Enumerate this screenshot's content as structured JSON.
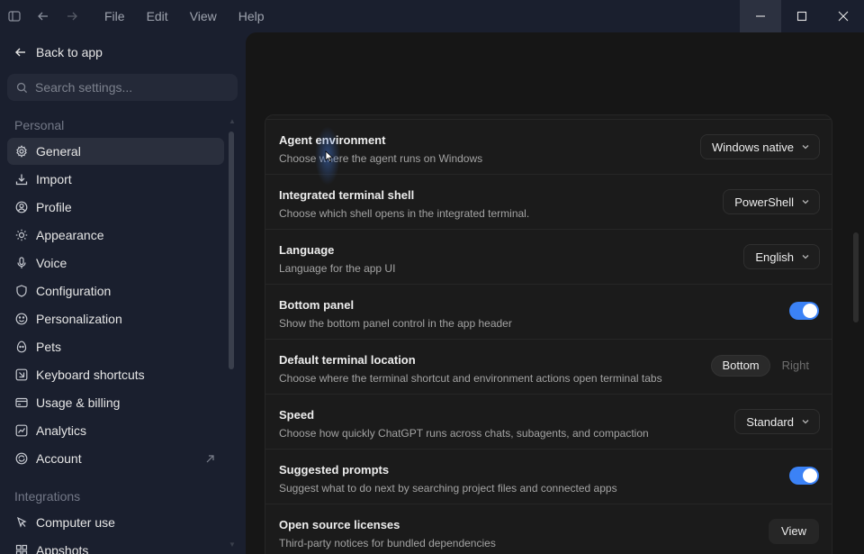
{
  "titlebar": {
    "menus": [
      "File",
      "Edit",
      "View",
      "Help"
    ]
  },
  "sidebar": {
    "back_label": "Back to app",
    "search_placeholder": "Search settings...",
    "personal_label": "Personal",
    "integrations_label": "Integrations",
    "personal_items": [
      {
        "label": "General",
        "icon": "gear-icon",
        "active": true
      },
      {
        "label": "Import",
        "icon": "download-icon"
      },
      {
        "label": "Profile",
        "icon": "user-icon"
      },
      {
        "label": "Appearance",
        "icon": "sun-icon"
      },
      {
        "label": "Voice",
        "icon": "microphone-icon"
      },
      {
        "label": "Configuration",
        "icon": "shield-icon"
      },
      {
        "label": "Personalization",
        "icon": "personalization-icon"
      },
      {
        "label": "Pets",
        "icon": "egg-icon"
      },
      {
        "label": "Keyboard shortcuts",
        "icon": "keyboard-icon"
      },
      {
        "label": "Usage & billing",
        "icon": "credit-card-icon"
      },
      {
        "label": "Analytics",
        "icon": "chart-icon"
      },
      {
        "label": "Account",
        "icon": "account-icon",
        "external": true
      }
    ],
    "integration_items": [
      {
        "label": "Computer use",
        "icon": "pointer-icon"
      },
      {
        "label": "Appshots",
        "icon": "grid-icon"
      }
    ]
  },
  "settings": {
    "rows": [
      {
        "title": "Agent environment",
        "desc": "Choose where the agent runs on Windows",
        "control": "dropdown",
        "value": "Windows native"
      },
      {
        "title": "Integrated terminal shell",
        "desc": "Choose which shell opens in the integrated terminal.",
        "control": "dropdown",
        "value": "PowerShell"
      },
      {
        "title": "Language",
        "desc": "Language for the app UI",
        "control": "dropdown",
        "value": "English"
      },
      {
        "title": "Bottom panel",
        "desc": "Show the bottom panel control in the app header",
        "control": "toggle",
        "on": true
      },
      {
        "title": "Default terminal location",
        "desc": "Choose where the terminal shortcut and environment actions open terminal tabs",
        "control": "segmented",
        "options": [
          "Bottom",
          "Right"
        ],
        "selected": "Bottom"
      },
      {
        "title": "Speed",
        "desc": "Choose how quickly ChatGPT runs across chats, subagents, and compaction",
        "control": "dropdown",
        "value": "Standard"
      },
      {
        "title": "Suggested prompts",
        "desc": "Suggest what to do next by searching project files and connected apps",
        "control": "toggle",
        "on": true
      },
      {
        "title": "Open source licenses",
        "desc": "Third-party notices for bundled dependencies",
        "control": "button",
        "value": "View"
      }
    ]
  },
  "colors": {
    "sidebar_bg": "#1a1f2e",
    "main_bg": "#161616",
    "accent": "#3b82f6"
  }
}
